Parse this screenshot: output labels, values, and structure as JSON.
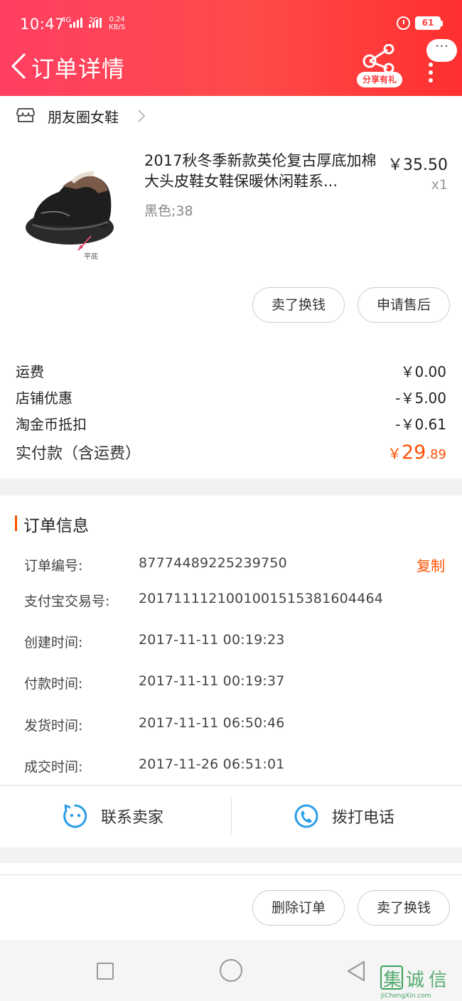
{
  "status_bar": {
    "time": "10:47",
    "net_4g": "4G",
    "net_2g": "2G",
    "speed_value": "0.24",
    "speed_unit": "KB/S",
    "battery": "61"
  },
  "header": {
    "title": "订单详情",
    "share_label": "分享有礼",
    "more_label": "···"
  },
  "shop": {
    "name": "朋友圈女鞋"
  },
  "product": {
    "title": "2017秋冬季新款英伦复古厚底加棉大头皮鞋女鞋保暖休闲鞋系...",
    "spec": "黑色;38",
    "price": "￥35.50",
    "qty": "x1",
    "image_caption": "平底"
  },
  "item_actions": {
    "resell": "卖了换钱",
    "after_sale": "申请售后"
  },
  "fees": [
    {
      "label": "运费",
      "value": "￥0.00"
    },
    {
      "label": "店铺优惠",
      "value": "-￥5.00"
    },
    {
      "label": "淘金币抵扣",
      "value": "-￥0.61"
    }
  ],
  "total": {
    "label": "实付款（含运费）",
    "symbol": "￥",
    "integer": "29",
    "decimal": ".89"
  },
  "order_info": {
    "title": "订单信息",
    "copy_label": "复制",
    "rows": [
      {
        "label": "订单编号:",
        "value": "87774489225239750"
      },
      {
        "label": "支付宝交易号:",
        "value": "2017111121001001515381604464"
      },
      {
        "label": "创建时间:",
        "value": "2017-11-11 00:19:23"
      },
      {
        "label": "付款时间:",
        "value": "2017-11-11 00:19:37"
      },
      {
        "label": "发货时间:",
        "value": "2017-11-11 06:50:46"
      },
      {
        "label": "成交时间:",
        "value": "2017-11-26 06:51:01"
      }
    ]
  },
  "contact": {
    "seller": "联系卖家",
    "call": "拨打电话"
  },
  "bottom_actions": {
    "delete": "删除订单",
    "resell": "卖了换钱"
  },
  "watermark": {
    "main": "集诚信",
    "sub": "JiChengXin.com"
  },
  "colors": {
    "header_start": "#ff3f62",
    "header_end": "#ff2f2f",
    "accent_orange": "#ff5000",
    "icon_blue": "#2a9ee8"
  }
}
